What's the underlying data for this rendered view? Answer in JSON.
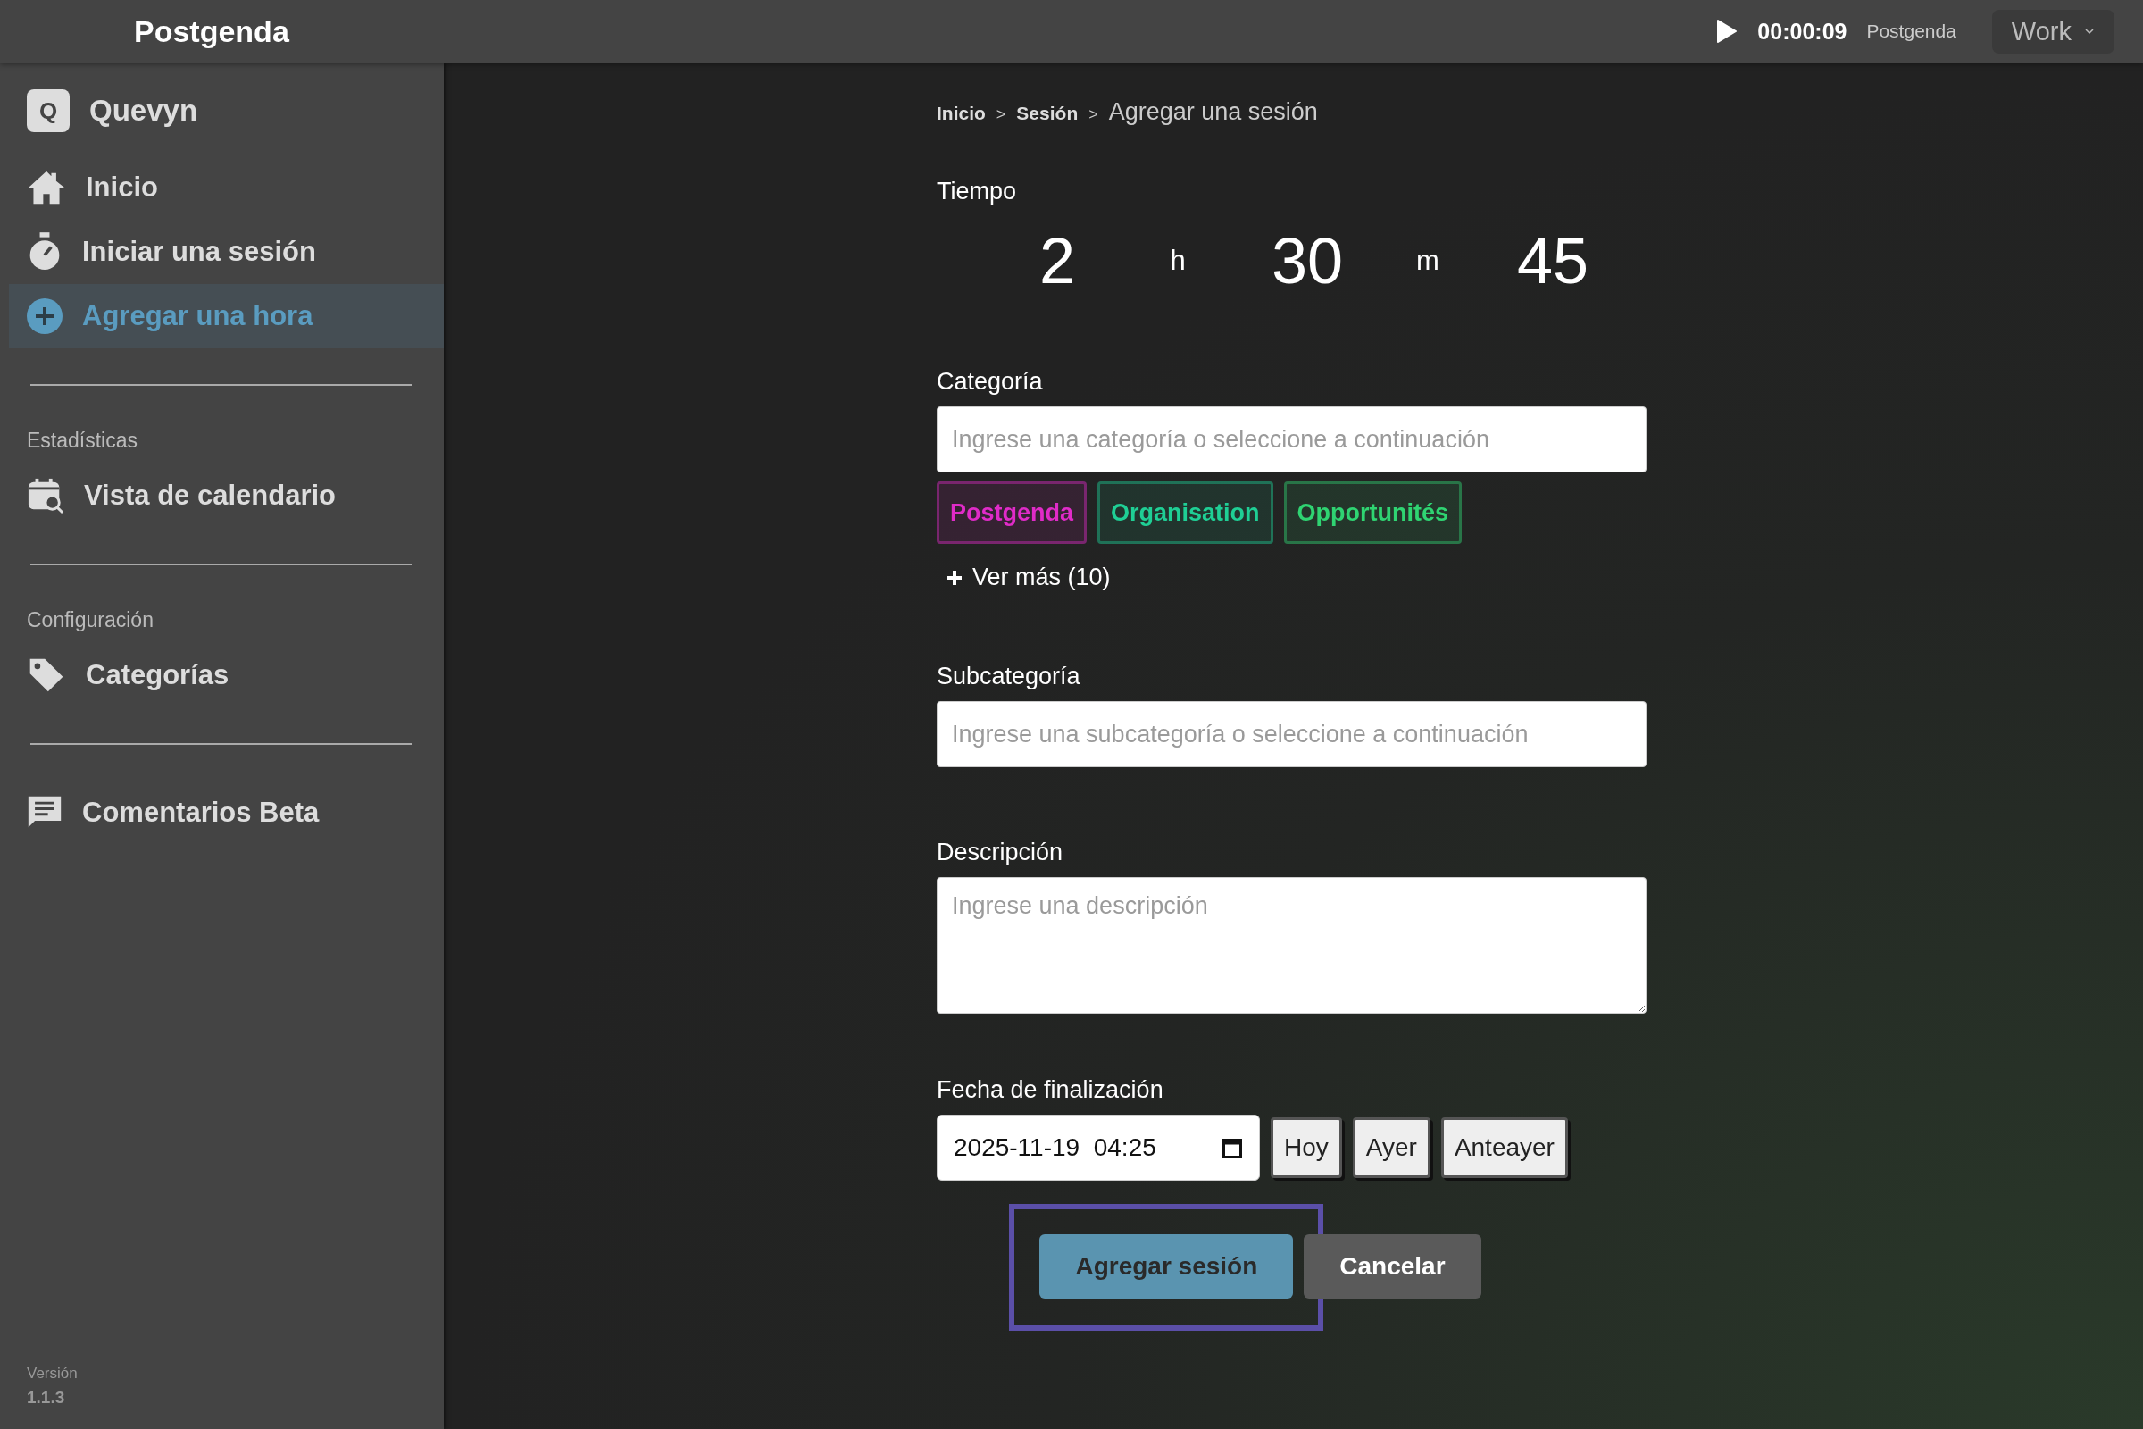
{
  "top_bar": {
    "title": "Postgenda",
    "timer": "00:00:09",
    "timer_project": "Postgenda",
    "workspace": "Work"
  },
  "sidebar": {
    "user": {
      "initial": "Q",
      "name": "Quevyn"
    },
    "sections": [
      {
        "items": [
          {
            "label": "Inicio",
            "selected": false
          },
          {
            "label": "Iniciar una sesión",
            "selected": false
          },
          {
            "label": "Agregar una hora",
            "selected": true
          }
        ]
      },
      {
        "heading": "Estadísticas",
        "items": [
          {
            "label": "Vista de calendario",
            "selected": false
          }
        ]
      },
      {
        "heading": "Configuración",
        "items": [
          {
            "label": "Categorías",
            "selected": false
          }
        ]
      },
      {
        "items": [
          {
            "label": "Comentarios Beta",
            "selected": false
          }
        ]
      }
    ],
    "version_label": "Versión",
    "version": "1.1.3"
  },
  "breadcrumb": [
    {
      "label": "Inicio",
      "current": false
    },
    {
      "label": "Sesión",
      "current": false
    },
    {
      "label": "Agregar una sesión",
      "current": true
    }
  ],
  "breadcrumb_separator": ">",
  "time": {
    "label": "Tiempo",
    "parts": [
      {
        "value": "2",
        "unit": "h"
      },
      {
        "value": "30",
        "unit": "m"
      },
      {
        "value": "45"
      }
    ]
  },
  "category": {
    "label": "Categoría",
    "placeholder": "Ingrese una categoría o seleccione a continuación",
    "chips": [
      {
        "label": "Postgenda",
        "color": "#e02bc8"
      },
      {
        "label": "Organisation",
        "color": "#1fcf95"
      },
      {
        "label": "Opportunités",
        "color": "#2fd472"
      }
    ],
    "more": "Ver más (10)"
  },
  "subcategory": {
    "label": "Subcategoría",
    "placeholder": "Ingrese una subcategoría o seleccione a continuación"
  },
  "description": {
    "label": "Descripción",
    "placeholder": "Ingrese una descripción"
  },
  "end_date": {
    "label": "Fecha de finalización",
    "value": "2025-11-19  04:25",
    "shortcuts": [
      "Hoy",
      "Ayer",
      "Anteayer"
    ]
  },
  "actions": [
    {
      "label": "Agregar sesión",
      "kind": "primary",
      "focused": true
    },
    {
      "label": "Cancelar",
      "kind": "secondary",
      "focused": false
    }
  ]
}
